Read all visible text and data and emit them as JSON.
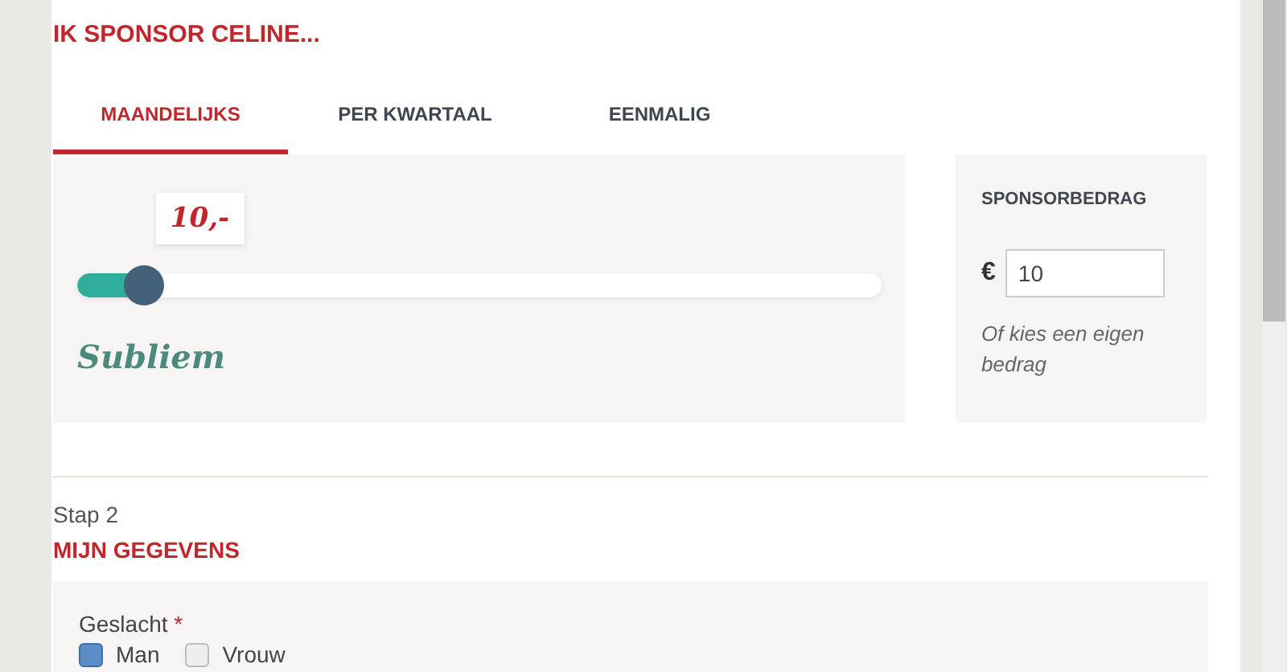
{
  "step1": {
    "title": "IK SPONSOR CELINE..."
  },
  "tabs": [
    {
      "label": "MAANDELIJKS",
      "selected": true
    },
    {
      "label": "PER KWARTAAL",
      "selected": false
    },
    {
      "label": "EENMALIG",
      "selected": false
    }
  ],
  "slider": {
    "bubble": "10,-",
    "level": 0.084,
    "caption": "Subliem"
  },
  "amount": {
    "heading": "SPONSORBEDRAG",
    "currency": "€",
    "value": "10",
    "hint": "Of kies een eigen bedrag"
  },
  "step2": {
    "step": "Stap 2",
    "title": "MIJN GEGEVENS"
  },
  "form": {
    "label": "Geslacht",
    "required": "*",
    "options": [
      {
        "label": "Man",
        "checked": true
      },
      {
        "label": "Vrouw",
        "checked": false
      }
    ]
  }
}
